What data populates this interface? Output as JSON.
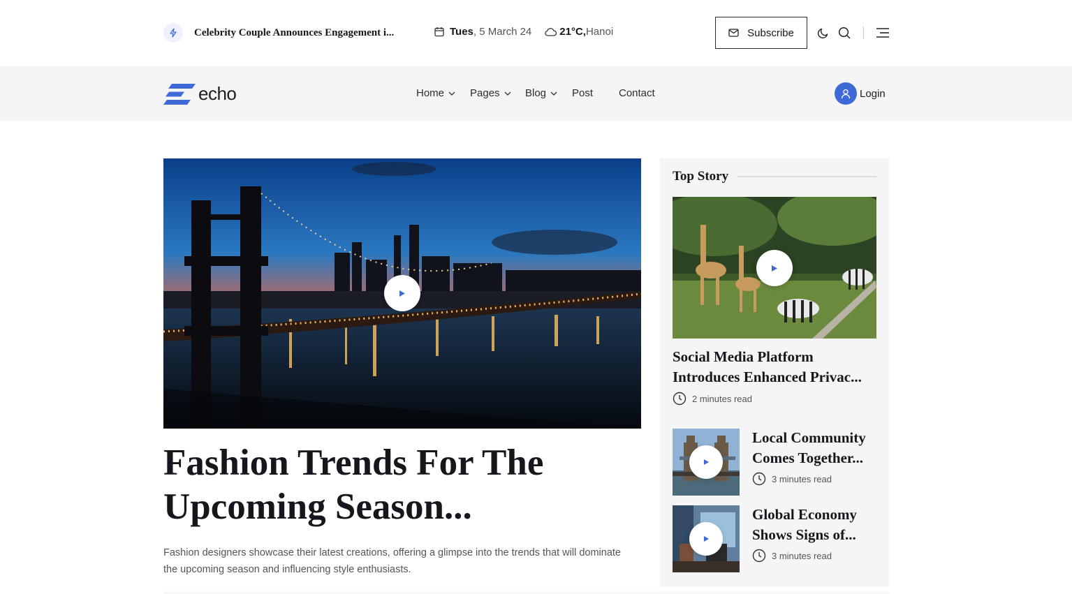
{
  "topbar": {
    "breaking_icon": "lightning-bolt-icon",
    "breaking_headline": "Celebrity Couple Announces Engagement i...",
    "date_day": "Tues",
    "date_rest": ", 5 March 24",
    "weather_temp": "21°C,",
    "weather_city": " Hanoi",
    "subscribe_label": "Subscribe"
  },
  "nav": {
    "logo_text": "echo",
    "items": [
      {
        "label": "Home",
        "dropdown": true
      },
      {
        "label": "Pages",
        "dropdown": true
      },
      {
        "label": "Blog",
        "dropdown": true
      },
      {
        "label": "Post",
        "dropdown": false
      },
      {
        "label": "Contact",
        "dropdown": false
      }
    ],
    "login_label": "Login"
  },
  "hero": {
    "title": "Fashion Trends For The Upcoming Season...",
    "description": "Fashion designers showcase their latest creations, offering a glimpse into the trends that will dominate the upcoming season and influencing style enthusiasts."
  },
  "sidebar": {
    "heading": "Top Story",
    "main": {
      "title": "Social Media Platform Introduces Enhanced Privac...",
      "read_time": "2 minutes read"
    },
    "items": [
      {
        "title": "Local Community Comes Together...",
        "read_time": "3 minutes read"
      },
      {
        "title": "Global Economy Shows Signs of...",
        "read_time": "3 minutes read"
      }
    ]
  },
  "colors": {
    "accent": "#3e6ad8",
    "text_dark": "#16161d",
    "nav_bg": "#f5f5f5"
  }
}
